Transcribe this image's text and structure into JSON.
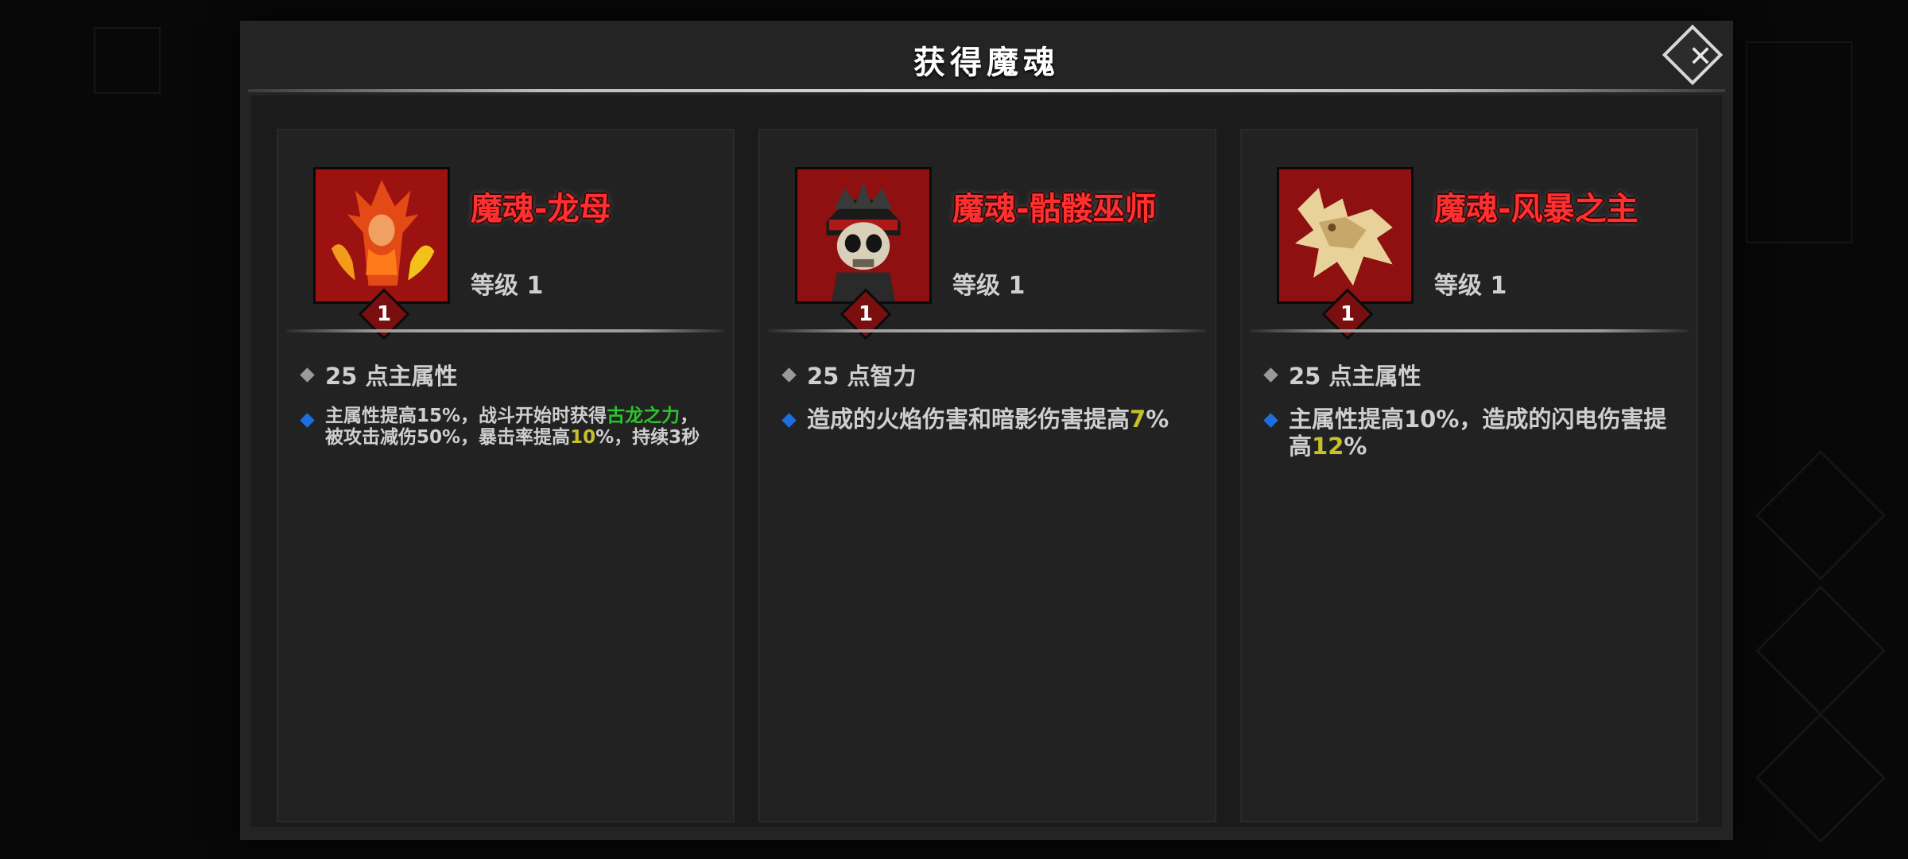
{
  "modal": {
    "title": "获得魔魂",
    "close_label": "✕"
  },
  "cards": [
    {
      "name": "魔魂-龙母",
      "level_text": "等级 1",
      "badge_level": "1",
      "portrait_icon": "dragon-mother-portrait",
      "stat": "25 点主属性",
      "effect": {
        "parts": [
          "主属性提高15%，战斗开始时获得",
          "古龙之力",
          "，被攻击减伤50%，暴击率提高",
          "10",
          "%，持续3秒"
        ]
      }
    },
    {
      "name": "魔魂-骷髅巫师",
      "level_text": "等级 1",
      "badge_level": "1",
      "portrait_icon": "skeleton-wizard-portrait",
      "stat": "25 点智力",
      "effect": {
        "parts": [
          "造成的火焰伤害和暗影伤害提高",
          "7",
          "%"
        ]
      }
    },
    {
      "name": "魔魂-风暴之主",
      "level_text": "等级 1",
      "badge_level": "1",
      "portrait_icon": "storm-lord-portrait",
      "stat": "25 点主属性",
      "effect": {
        "parts": [
          "主属性提高10%，造成的闪电伤害提高",
          "12",
          "%"
        ]
      }
    }
  ],
  "colors": {
    "name_red": "#ff3030",
    "highlight_green": "#2cc42c",
    "highlight_yellow": "#c6c02b",
    "effect_bullet_blue": "#1d6fe0"
  }
}
